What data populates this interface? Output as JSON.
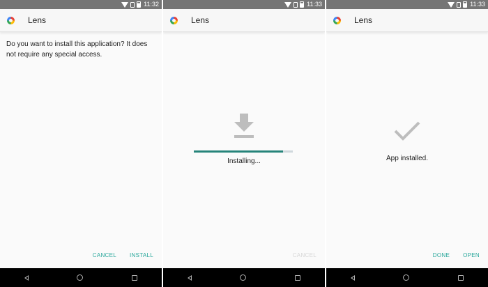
{
  "screens": [
    {
      "status_time": "11:32",
      "app_name": "Lens",
      "message": "Do you want to install this application? It does not require any special access.",
      "actions": {
        "cancel": "CANCEL",
        "install": "INSTALL"
      }
    },
    {
      "status_time": "11:33",
      "app_name": "Lens",
      "status": "Installing...",
      "progress": 0.9,
      "actions": {
        "cancel": "CANCEL"
      }
    },
    {
      "status_time": "11:33",
      "app_name": "Lens",
      "status": "App installed.",
      "actions": {
        "done": "DONE",
        "open": "OPEN"
      }
    }
  ],
  "colors": {
    "status_bar": "#757575",
    "accent": "#26a69a",
    "progress_fill": "#26847a",
    "progress_track": "#cfd8dc",
    "icon_gray": "#bdbdbd"
  },
  "icons": [
    "wifi-icon",
    "sim-icon",
    "battery-icon",
    "app-icon",
    "download-icon",
    "check-icon",
    "back-icon",
    "home-icon",
    "recents-icon"
  ]
}
